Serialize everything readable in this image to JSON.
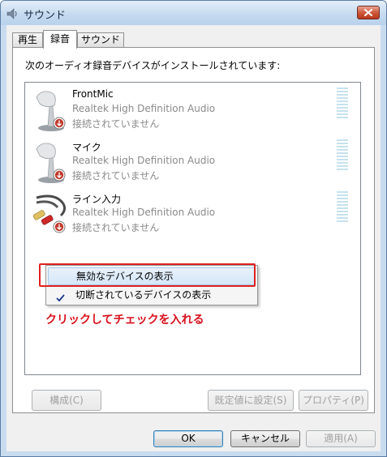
{
  "window": {
    "title": "サウンド"
  },
  "tabs": [
    {
      "label": "再生",
      "active": false
    },
    {
      "label": "録音",
      "active": true
    },
    {
      "label": "サウンド",
      "active": false
    }
  ],
  "panel": {
    "caption": "次のオーディオ録音デバイスがインストールされています:"
  },
  "devices": [
    {
      "name": "FrontMic",
      "driver": "Realtek High Definition Audio",
      "status": "接続されていません",
      "icon": "microphone-icon"
    },
    {
      "name": "マイク",
      "driver": "Realtek High Definition Audio",
      "status": "接続されていません",
      "icon": "microphone-icon"
    },
    {
      "name": "ライン入力",
      "driver": "Realtek High Definition Audio",
      "status": "接続されていません",
      "icon": "rca-cable-icon"
    }
  ],
  "context_menu": {
    "items": [
      {
        "label": "無効なデバイスの表示",
        "checked": false,
        "hovered": true
      },
      {
        "label": "切断されているデバイスの表示",
        "checked": true,
        "hovered": false
      }
    ]
  },
  "annotation": {
    "text": "クリックしてチェックを入れる",
    "color": "#d8101c"
  },
  "panel_buttons": {
    "configure": "構成(C)",
    "set_default": "既定値に設定(S)",
    "properties": "プロパティ(P)"
  },
  "dialog_buttons": {
    "ok": "OK",
    "cancel": "キャンセル",
    "apply": "適用(A)"
  }
}
